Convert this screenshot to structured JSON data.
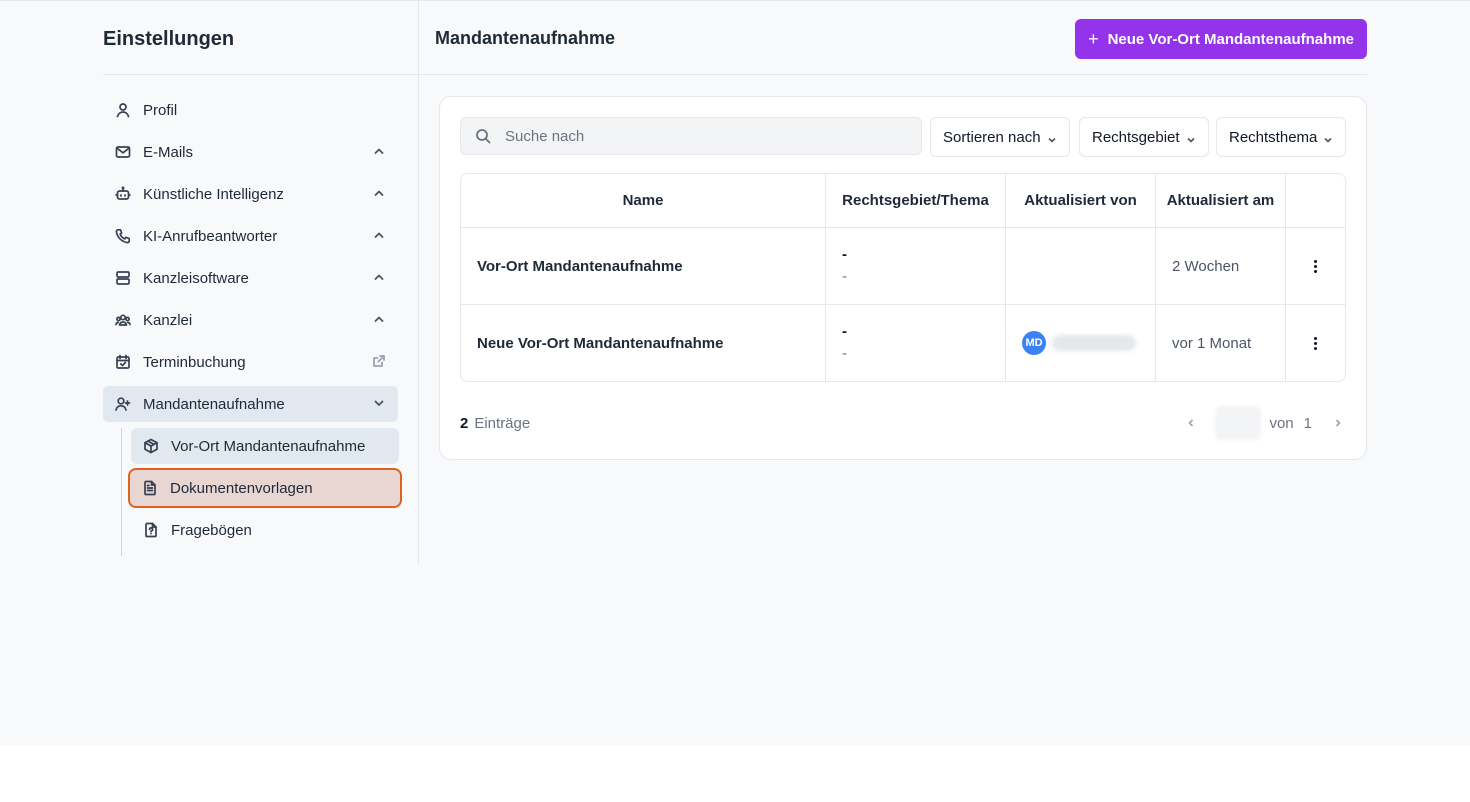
{
  "sidebar": {
    "title": "Einstellungen",
    "items": [
      {
        "label": "Profil",
        "icon": "user-icon"
      },
      {
        "label": "E-Mails",
        "icon": "mail-icon"
      },
      {
        "label": "Künstliche Intelligenz",
        "icon": "bot-icon"
      },
      {
        "label": "KI-Anrufbeantworter",
        "icon": "phone-icon"
      },
      {
        "label": "Kanzleisoftware",
        "icon": "server-icon"
      },
      {
        "label": "Kanzlei",
        "icon": "team-icon"
      },
      {
        "label": "Terminbuchung",
        "icon": "calendar-check-icon"
      },
      {
        "label": "Mandantenaufnahme",
        "icon": "user-plus-icon"
      }
    ],
    "subitems": [
      {
        "label": "Vor-Ort Mandantenaufnahme",
        "icon": "package-icon"
      },
      {
        "label": "Dokumentenvorlagen",
        "icon": "file-text-icon"
      },
      {
        "label": "Fragebögen",
        "icon": "file-question-icon"
      }
    ]
  },
  "header": {
    "title": "Mandantenaufnahme",
    "new_button": "Neue Vor-Ort Mandantenaufnahme"
  },
  "toolbar": {
    "search_placeholder": "Suche nach",
    "sort_label": "Sortieren nach",
    "filter_area": "Rechtsgebiet",
    "filter_topic": "Rechtsthema"
  },
  "table": {
    "columns": [
      "Name",
      "Rechtsgebiet/Thema",
      "Aktualisiert von",
      "Aktualisiert am"
    ],
    "rows": [
      {
        "name": "Vor-Ort Mandantenaufnahme",
        "area": "-",
        "topic": "-",
        "updated_by_initials": "",
        "updated_at": "2 Wochen"
      },
      {
        "name": "Neue Vor-Ort Mandantenaufnahme",
        "area": "-",
        "topic": "-",
        "updated_by_initials": "MD",
        "updated_at": "vor 1 Monat"
      }
    ]
  },
  "footer": {
    "count": "2",
    "count_label": "Einträge",
    "of_label": "von",
    "total_pages": "1"
  },
  "colors": {
    "primary": "#9333ea",
    "highlight_border": "#e0621c",
    "avatar": "#3b82f6"
  }
}
